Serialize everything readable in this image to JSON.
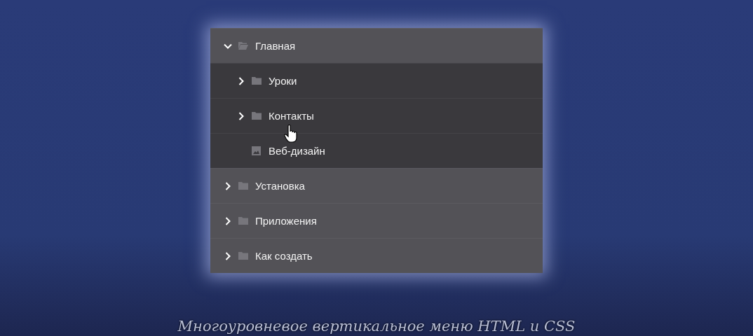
{
  "menu": {
    "items": [
      {
        "label": "Главная",
        "kind": "folder",
        "expanded": true,
        "children": [
          {
            "label": "Уроки",
            "kind": "folder",
            "expanded": false
          },
          {
            "label": "Контакты",
            "kind": "folder",
            "expanded": false
          },
          {
            "label": "Веб-дизайн",
            "kind": "image"
          }
        ]
      },
      {
        "label": "Установка",
        "kind": "folder",
        "expanded": false
      },
      {
        "label": "Приложения",
        "kind": "folder",
        "expanded": false
      },
      {
        "label": "Как создать",
        "kind": "folder",
        "expanded": false
      }
    ]
  },
  "caption": "Многоуровневое вертикальное меню HTML и CSS"
}
